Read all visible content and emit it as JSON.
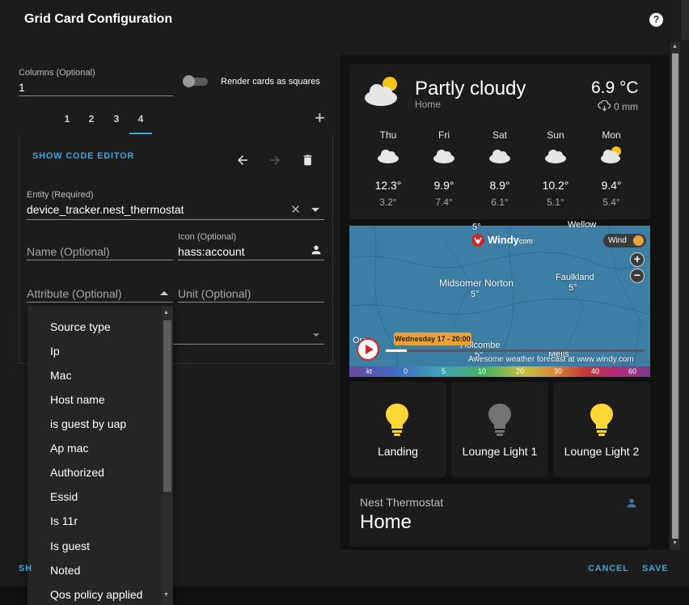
{
  "dialog": {
    "title": "Grid Card Configuration",
    "help_glyph": "?"
  },
  "grid": {
    "columns_label": "Columns (Optional)",
    "columns_value": "1",
    "squares_label": "Render cards as squares",
    "squares_on": false,
    "tabs": [
      "1",
      "2",
      "3",
      "4"
    ],
    "active_tab": "4",
    "add_glyph": "+"
  },
  "editor": {
    "show_code": "SHOW CODE EDITOR",
    "entity_label": "Entity (Required)",
    "entity_value": "device_tracker.nest_thermostat",
    "name_placeholder": "Name (Optional)",
    "icon_label": "Icon (Optional)",
    "icon_value": "hass:account",
    "attribute_placeholder": "Attribute (Optional)",
    "unit_placeholder": "Unit (Optional)"
  },
  "attribute_options": [
    "Source type",
    "Ip",
    "Mac",
    "Host name",
    "is guest by uap",
    "Ap mac",
    "Authorized",
    "Essid",
    "Is 11r",
    "Is guest",
    "Noted",
    "Qos policy applied"
  ],
  "preview": {
    "weather": {
      "condition": "Partly cloudy",
      "location": "Home",
      "temperature": "6.9 °C",
      "precipitation": "0 mm",
      "forecast": [
        {
          "day": "Thu",
          "high": "12.3°",
          "low": "3.2°",
          "icon": "cloudy-icon"
        },
        {
          "day": "Fri",
          "high": "9.9°",
          "low": "7.4°",
          "icon": "cloudy-icon"
        },
        {
          "day": "Sat",
          "high": "8.9°",
          "low": "6.1°",
          "icon": "cloudy-icon"
        },
        {
          "day": "Sun",
          "high": "10.2°",
          "low": "5.1°",
          "icon": "cloudy-icon"
        },
        {
          "day": "Mon",
          "high": "9.4°",
          "low": "5.4°",
          "icon": "partly-cloudy-icon"
        }
      ]
    },
    "map": {
      "logo": "Windy",
      "logo_suffix": "com",
      "wind_button": "Wind",
      "zoom_in": "+",
      "zoom_out": "−",
      "places": [
        {
          "name": "Midsomer Norton",
          "temp": "5°"
        },
        {
          "name": "Faulkland",
          "temp": "5°"
        },
        {
          "name": "Holcombe",
          "temp": "5°"
        },
        {
          "name": "Mells",
          "temp": ""
        },
        {
          "name": "Wellow",
          "temp": "5°"
        },
        {
          "name": "Oro",
          "temp": ""
        }
      ],
      "time_label": "Wednesday 17 - 20:00",
      "attribution": "Awesome weather forecast at www.windy.com",
      "timeline_progress": 0.08,
      "scale_unit": "kt",
      "scale": [
        "0",
        "5",
        "10",
        "20",
        "30",
        "40",
        "60"
      ]
    },
    "lights": [
      {
        "name": "Landing",
        "state": "on",
        "color": "#fdd835"
      },
      {
        "name": "Lounge Light 1",
        "state": "off",
        "color": "#737373"
      },
      {
        "name": "Lounge Light 2",
        "state": "on",
        "color": "#fdd835"
      }
    ],
    "entity": {
      "name": "Nest Thermostat",
      "state": "Home",
      "icon": "account-icon",
      "icon_color": "#44739e"
    }
  },
  "footer": {
    "left_partial": "SH",
    "cancel": "CANCEL",
    "save": "SAVE"
  },
  "colors": {
    "accent": "#3fa6dc",
    "background": "#1c1c1c",
    "light_on": "#fdd835",
    "light_off": "#737373"
  }
}
